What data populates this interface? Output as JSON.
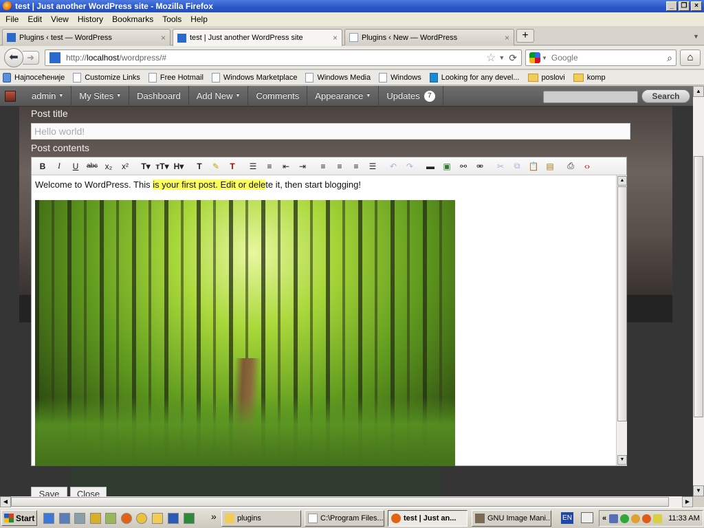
{
  "window": {
    "title": "test | Just another WordPress site - Mozilla Firefox"
  },
  "menu": [
    "File",
    "Edit",
    "View",
    "History",
    "Bookmarks",
    "Tools",
    "Help"
  ],
  "tabs": [
    {
      "label": "Plugins ‹ test — WordPress"
    },
    {
      "label": "test | Just another WordPress site"
    },
    {
      "label": "Plugins ‹ New — WordPress"
    }
  ],
  "nav": {
    "url_prefix": "http://",
    "url_host": "localhost",
    "url_path": "/wordpress/#",
    "search_placeholder": "Google"
  },
  "bookmarks": [
    "Најпосећеније",
    "Customize Links",
    "Free Hotmail",
    "Windows Marketplace",
    "Windows Media",
    "Windows",
    "Looking for any devel...",
    "poslovi",
    "komp"
  ],
  "adminbar": {
    "items": [
      {
        "label": "admin",
        "caret": "▼"
      },
      {
        "label": "My Sites",
        "caret": "▼"
      },
      {
        "label": "Dashboard",
        "caret": ""
      },
      {
        "label": "Add New",
        "caret": "▼"
      },
      {
        "label": "Comments",
        "caret": ""
      },
      {
        "label": "Appearance",
        "caret": "▼"
      },
      {
        "label": "Updates",
        "caret": ""
      }
    ],
    "updates_count": "7",
    "search_button": "Search"
  },
  "editor": {
    "title_label": "Post title",
    "title_placeholder": "Hello world!",
    "contents_label": "Post contents",
    "content_before": "Welcome to WordPress. This ",
    "content_highlight": "is your first post. Edit or dele",
    "content_after": "te it, then start blogging!",
    "save_label": "Save",
    "close_label": "Close"
  },
  "taskbar": {
    "start": "Start",
    "tasks": [
      {
        "label": "plugins"
      },
      {
        "label": "C:\\Program Files..."
      },
      {
        "label": "test | Just an..."
      },
      {
        "label": "GNU Image Mani..."
      }
    ],
    "lang": "EN",
    "clock": "11:33 AM"
  }
}
